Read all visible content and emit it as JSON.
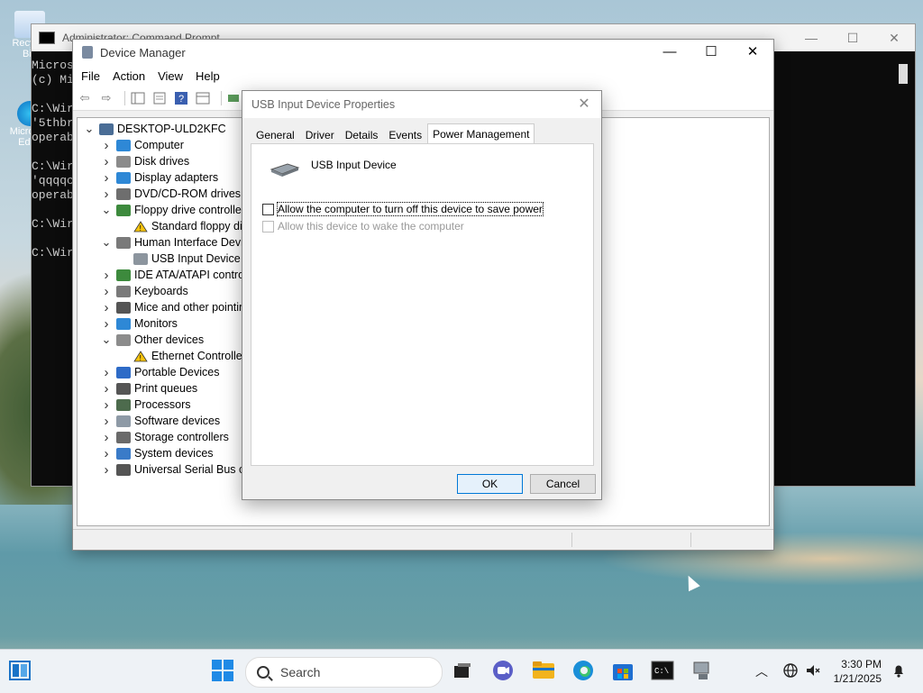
{
  "desktop": {
    "icons": [
      {
        "label": "Recycle Bin"
      },
      {
        "label": "Microsoft Edge"
      }
    ]
  },
  "cmd": {
    "title": "Administrator: Command Prompt",
    "lines": [
      "Microsoft Windows",
      "(c) Mi",
      "",
      "C:\\Wir",
      "'5thbr",
      "operab",
      "",
      "C:\\Wir",
      "'qqqqc",
      "operab",
      "",
      "C:\\Wir",
      "",
      "C:\\Wir"
    ],
    "minimize": "—",
    "maximize": "☐",
    "close": "✕"
  },
  "device_manager": {
    "title": "Device Manager",
    "menu": [
      "File",
      "Action",
      "View",
      "Help"
    ],
    "win_controls": {
      "minimize": "—",
      "maximize": "☐",
      "close": "✕"
    },
    "tree": [
      {
        "label": "DESKTOP-ULD2KFC",
        "level": 0,
        "expanded": true,
        "icon": "computer-icon"
      },
      {
        "label": "Computer",
        "level": 1,
        "expanded": false,
        "icon": "monitor-icon"
      },
      {
        "label": "Disk drives",
        "level": 1,
        "expanded": false,
        "icon": "disk-icon"
      },
      {
        "label": "Display adapters",
        "level": 1,
        "expanded": false,
        "icon": "display-icon"
      },
      {
        "label": "DVD/CD-ROM drives",
        "level": 1,
        "expanded": false,
        "icon": "dvd-icon"
      },
      {
        "label": "Floppy drive controllers",
        "level": 1,
        "expanded": true,
        "icon": "controller-icon"
      },
      {
        "label": "Standard floppy dis",
        "level": 2,
        "icon": "warning-device-icon"
      },
      {
        "label": "Human Interface Devic",
        "level": 1,
        "expanded": true,
        "icon": "keyboard-icon"
      },
      {
        "label": "USB Input Device",
        "level": 2,
        "icon": "hid-icon"
      },
      {
        "label": "IDE ATA/ATAPI controlle",
        "level": 1,
        "expanded": false,
        "icon": "controller-icon"
      },
      {
        "label": "Keyboards",
        "level": 1,
        "expanded": false,
        "icon": "keyboard-icon"
      },
      {
        "label": "Mice and other pointin",
        "level": 1,
        "expanded": false,
        "icon": "mouse-icon"
      },
      {
        "label": "Monitors",
        "level": 1,
        "expanded": false,
        "icon": "monitor-icon"
      },
      {
        "label": "Other devices",
        "level": 1,
        "expanded": true,
        "icon": "unknown-device-icon"
      },
      {
        "label": "Ethernet Controller",
        "level": 2,
        "icon": "warning-device-icon"
      },
      {
        "label": "Portable Devices",
        "level": 1,
        "expanded": false,
        "icon": "portable-icon"
      },
      {
        "label": "Print queues",
        "level": 1,
        "expanded": false,
        "icon": "printer-icon"
      },
      {
        "label": "Processors",
        "level": 1,
        "expanded": false,
        "icon": "cpu-icon"
      },
      {
        "label": "Software devices",
        "level": 1,
        "expanded": false,
        "icon": "software-icon"
      },
      {
        "label": "Storage controllers",
        "level": 1,
        "expanded": false,
        "icon": "storage-icon"
      },
      {
        "label": "System devices",
        "level": 1,
        "expanded": false,
        "icon": "system-icon"
      },
      {
        "label": "Universal Serial Bus cor",
        "level": 1,
        "expanded": false,
        "icon": "usb-icon"
      }
    ]
  },
  "dialog": {
    "title": "USB Input Device Properties",
    "close": "✕",
    "tabs": [
      "General",
      "Driver",
      "Details",
      "Events",
      "Power Management"
    ],
    "active_tab": "Power Management",
    "device_name": "USB Input Device",
    "options": [
      {
        "label": "Allow the computer to turn off this device to save power",
        "checked": false,
        "enabled": true
      },
      {
        "label": "Allow this device to wake the computer",
        "checked": false,
        "enabled": false
      }
    ],
    "ok_label": "OK",
    "cancel_label": "Cancel"
  },
  "taskbar": {
    "search_label": "Search",
    "time": "3:30 PM",
    "date": "1/21/2025"
  },
  "colors": {
    "accent": "#0078d7",
    "cmd_bg": "#0c0c0c",
    "window_bg": "#f0f0f0"
  }
}
